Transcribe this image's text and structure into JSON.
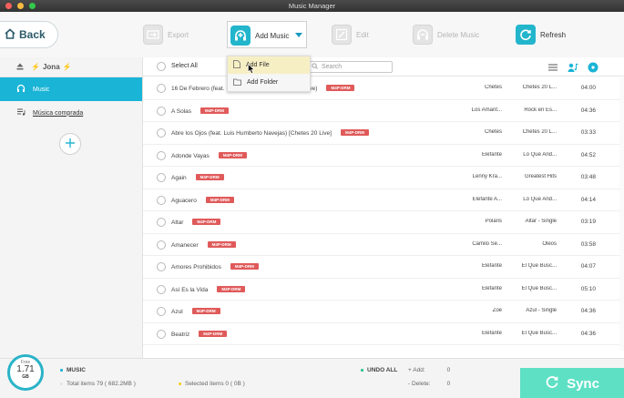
{
  "window": {
    "title": "Music Manager"
  },
  "toolbar": {
    "back_label": "Back",
    "export_label": "Export",
    "add_music_label": "Add Music",
    "edit_label": "Edit",
    "delete_label": "Delete Music",
    "refresh_label": "Refresh"
  },
  "dropdown": {
    "add_file": "Add File",
    "add_folder": "Add Folder"
  },
  "sidebar": {
    "device_name": "Jona",
    "items": [
      {
        "label": "Music"
      },
      {
        "label": "Música comprada"
      }
    ]
  },
  "list": {
    "select_all": "Select All",
    "search_placeholder": "Search",
    "drm_label": "M4P-DRM",
    "rows": [
      {
        "title": "16 De Febrero (feat.",
        "title_tail": "live)",
        "artist": "Chetes",
        "album": "Chetes 20 L...",
        "duration": "04:00"
      },
      {
        "title": "A Solas",
        "artist": "Los Amant...",
        "album": "Rock en Es...",
        "duration": "04:36"
      },
      {
        "title": "Abre los Ojos (feat. Luis Humberto Navejas) [Chetes 20 Live]",
        "artist": "Chetes",
        "album": "Chetes 20 L...",
        "duration": "03:33"
      },
      {
        "title": "Adonde Vayas",
        "artist": "Elefante",
        "album": "Lo Que And...",
        "duration": "04:52"
      },
      {
        "title": "Again",
        "artist": "Lenny Kra...",
        "album": "Greatest Hits",
        "duration": "03:48"
      },
      {
        "title": "Aguacero",
        "artist": "Elefante A...",
        "album": "Lo Que And...",
        "duration": "04:14"
      },
      {
        "title": "Altar",
        "artist": "Polaris",
        "album": "Altar - Single",
        "duration": "03:19"
      },
      {
        "title": "Amanecer",
        "artist": "Camilo Sé...",
        "album": "Óleos",
        "duration": "03:58"
      },
      {
        "title": "Amores Prohibidos",
        "artist": "Elefante",
        "album": "El Que Busc...",
        "duration": "04:07"
      },
      {
        "title": "Así Es la Vida",
        "artist": "Elefante",
        "album": "El Que Busc...",
        "duration": "05:10"
      },
      {
        "title": "Azul",
        "artist": "Zoé",
        "album": "Azul - Single",
        "duration": "04:36"
      },
      {
        "title": "Beatriz",
        "artist": "Elefante",
        "album": "El Que Busc...",
        "duration": "04:36"
      }
    ]
  },
  "storage": {
    "free_label": "Free",
    "value": "1.71",
    "unit": "GB"
  },
  "summary": {
    "category": "MUSIC",
    "total": "Total items 79 ( 682.2MB )",
    "selected": "Selected items 0 ( 0B )",
    "undo_all": "UNDO ALL",
    "add_label": "+ Add:",
    "add_value": "0",
    "delete_label": "- Delete:",
    "delete_value": "0"
  },
  "sync": {
    "label": "Sync"
  },
  "colors": {
    "accent": "#1ab4d6",
    "drm": "#e05a5a",
    "sync": "#5ee0c4"
  }
}
